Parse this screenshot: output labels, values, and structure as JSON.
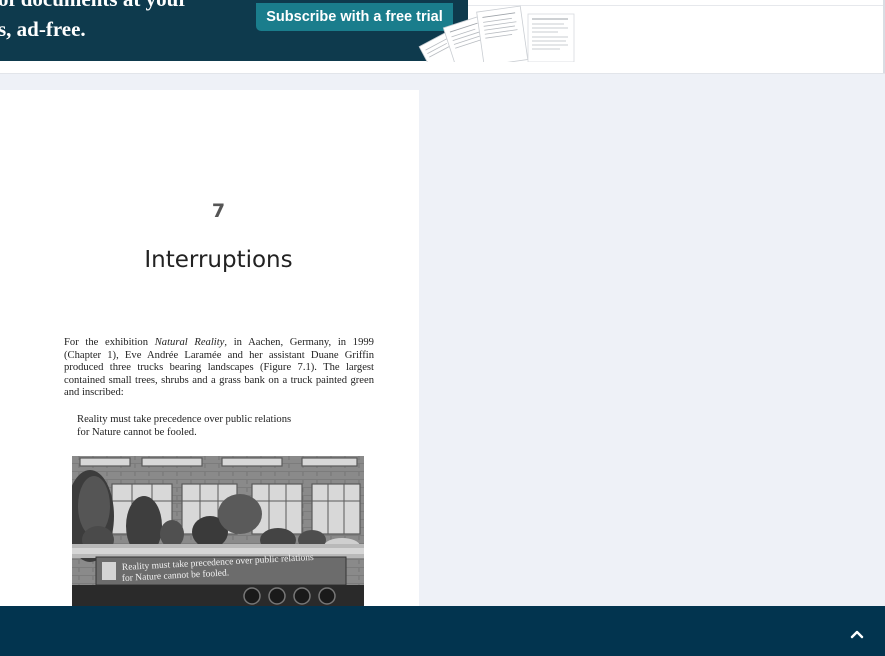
{
  "banner": {
    "line1": "of documents at your",
    "line2": "s, ad-free.",
    "subscribe_label": "Subscribe with a free trial"
  },
  "document": {
    "chapter_number": "7",
    "chapter_title": "Interruptions",
    "paragraph_parts": {
      "before": "For the exhibition ",
      "italic": "Natural Reality",
      "after": ", in Aachen, Germany, in 1999 (Chapter 1), Eve Andrée Laramée and her assistant Duane Griffin produced three trucks bearing landscapes (Figure 7.1). The largest contained small trees, shrubs and a grass bank on a truck painted green and inscribed:"
    },
    "quote_line1": "Reality must take precedence over public relations",
    "quote_line2": "for Nature cannot be fooled.",
    "photo_text_line1": "Reality must take precedence over public relations",
    "photo_text_line2": "for Nature cannot be fooled."
  },
  "bottom_bar": {
    "toggle_icon": "chevron-up-icon"
  },
  "colors": {
    "banner_bg": "#0e3a4d",
    "subscribe_bg": "#1a7d8c",
    "bottom_bar_bg": "#02344f",
    "viewer_bg": "#eef1f7"
  }
}
